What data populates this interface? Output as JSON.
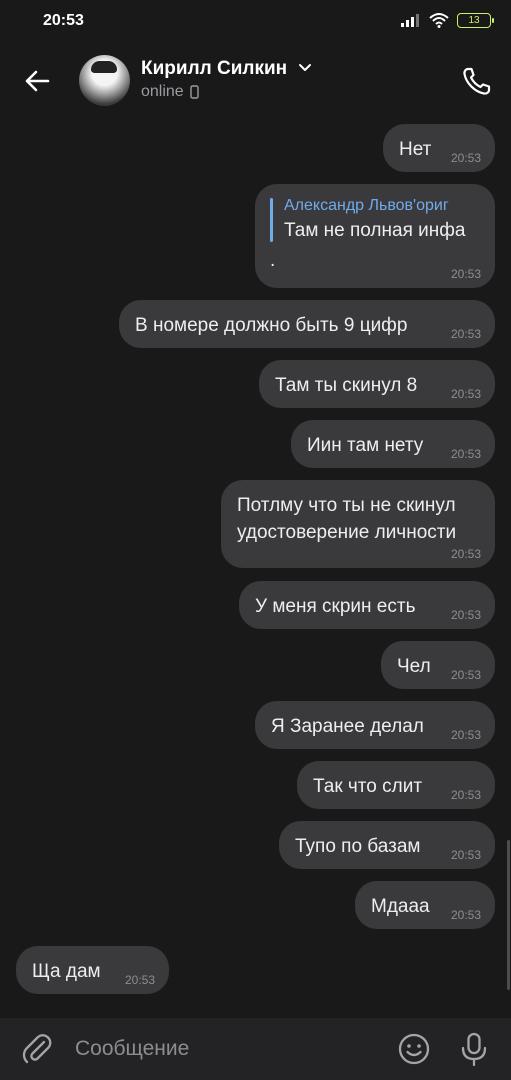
{
  "status": {
    "time": "20:53",
    "battery": "13"
  },
  "header": {
    "name": "Кирилл Силкин",
    "status": "online"
  },
  "messages": [
    {
      "text": "Нет",
      "time": "20:53"
    },
    {
      "quote_author": "Александр Львов'ориг",
      "quote_text": "Там не полная инфа",
      "text": ".",
      "time": "20:53"
    },
    {
      "text": "В номере должно быть 9 цифр",
      "time": "20:53"
    },
    {
      "text": "Там ты скинул 8",
      "time": "20:53"
    },
    {
      "text": "Иин там нету",
      "time": "20:53"
    },
    {
      "line1": "Потлму что ты не скинул",
      "line2": "удостоверение личности",
      "time": "20:53"
    },
    {
      "text": "У меня скрин есть",
      "time": "20:53"
    },
    {
      "text": "Чел",
      "time": "20:53"
    },
    {
      "text": "Я Заранее делал",
      "time": "20:53"
    },
    {
      "text": "Так что слит",
      "time": "20:53"
    },
    {
      "text": "Тупо по базам",
      "time": "20:53"
    },
    {
      "text": "Мдааа",
      "time": "20:53"
    },
    {
      "text": "Ща дам",
      "time": "20:53"
    }
  ],
  "input": {
    "placeholder": "Сообщение"
  },
  "icons": {
    "back": "arrow-left-icon",
    "call": "phone-icon",
    "attach": "paperclip-icon",
    "emoji": "smile-icon",
    "mic": "microphone-icon",
    "chevron": "chevron-down-icon",
    "device": "mobile-device-icon"
  },
  "colors": {
    "accent": "#71aaeb",
    "bubble": "#3a3a3c",
    "background": "#19191a",
    "battery": "#c9f266"
  }
}
